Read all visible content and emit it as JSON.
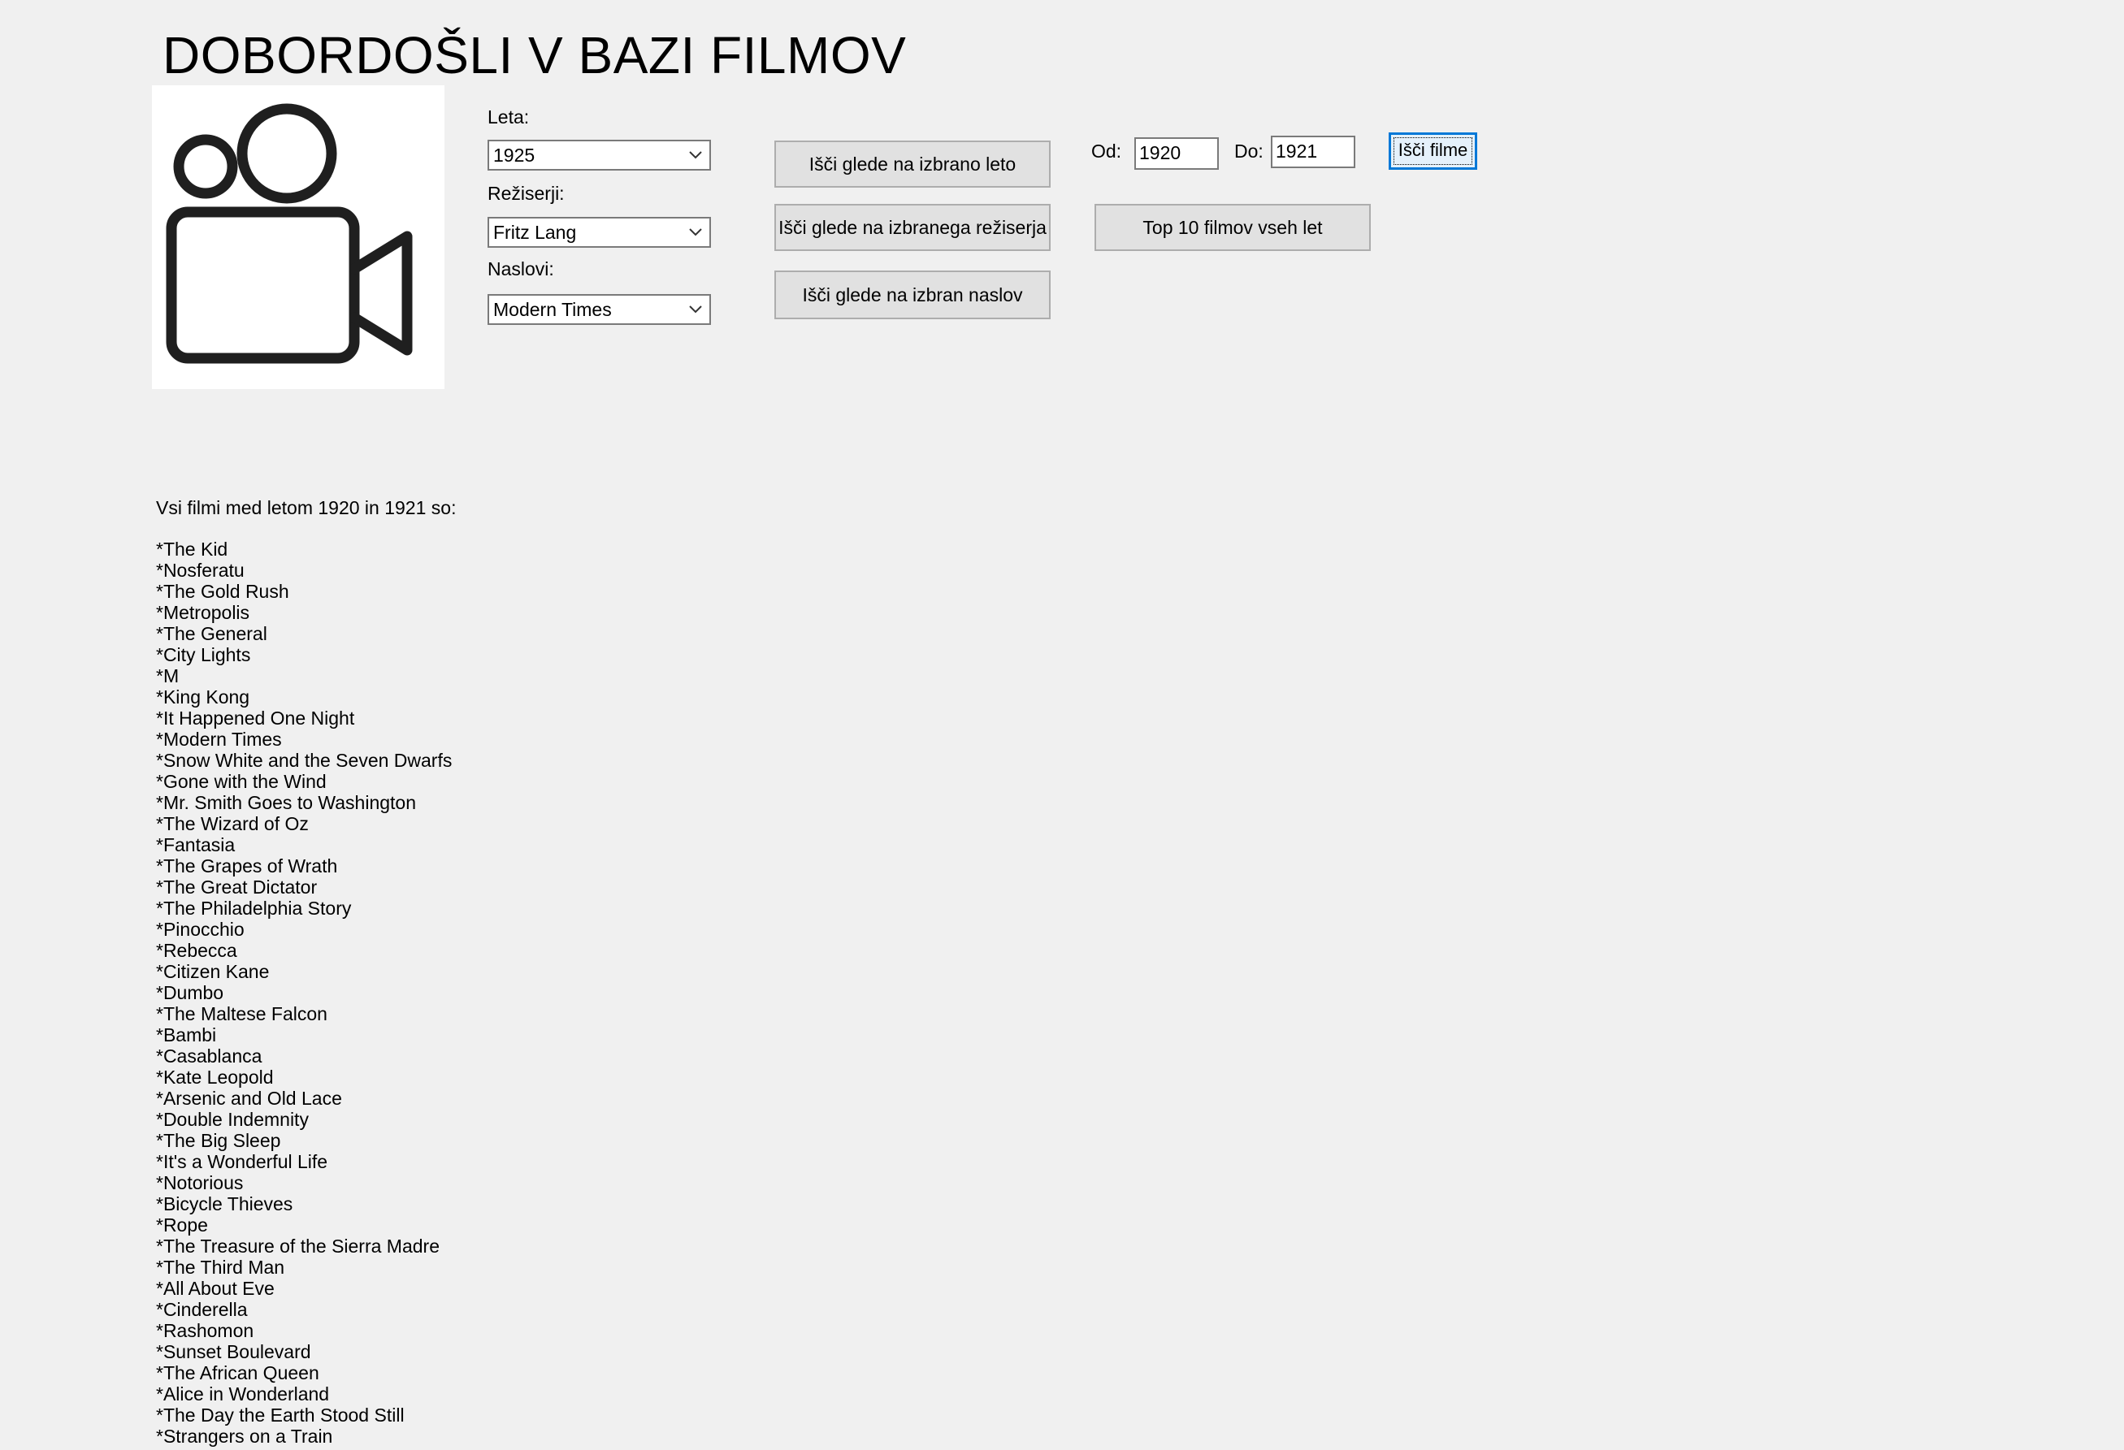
{
  "header": {
    "title": "DOBORDOŠLI V BAZI FILMOV"
  },
  "logo": {
    "icon": "video-camera-icon"
  },
  "filters": {
    "year_label": "Leta:",
    "year_selected": "1925",
    "director_label": "Režiserji:",
    "director_selected": "Fritz Lang",
    "title_label": "Naslovi:",
    "title_selected": "Modern Times"
  },
  "actions": {
    "search_year": "Išči glede na izbrano leto",
    "search_director": "Išči glede na izbranega režiserja",
    "search_title": "Išči glede na izbran naslov",
    "top10": "Top 10 filmov vseh let"
  },
  "range": {
    "from_label": "Od:",
    "from_value": "1920",
    "to_label": "Do:",
    "to_value": "1921",
    "search_button": "Išči filme"
  },
  "results": {
    "header": "Vsi filmi med letom 1920 in 1921 so:",
    "items": [
      "*The Kid",
      "*Nosferatu",
      "*The Gold Rush",
      "*Metropolis",
      "*The General",
      "*City Lights",
      "*M",
      "*King Kong",
      "*It Happened One Night",
      "*Modern Times",
      "*Snow White and the Seven Dwarfs",
      "*Gone with the Wind",
      "*Mr. Smith Goes to Washington",
      "*The Wizard of Oz",
      "*Fantasia",
      "*The Grapes of Wrath",
      "*The Great Dictator",
      "*The Philadelphia Story",
      "*Pinocchio",
      "*Rebecca",
      "*Citizen Kane",
      "*Dumbo",
      "*The Maltese Falcon",
      "*Bambi",
      "*Casablanca",
      "*Kate  Leopold",
      "*Arsenic and Old Lace",
      "*Double Indemnity",
      "*The Big Sleep",
      "*It's a Wonderful Life",
      "*Notorious",
      "*Bicycle Thieves",
      "*Rope",
      "*The Treasure of the Sierra Madre",
      "*The Third Man",
      "*All About Eve",
      "*Cinderella",
      "*Rashomon",
      "*Sunset Boulevard",
      "*The African Queen",
      "*Alice in Wonderland",
      "*The Day the Earth Stood Still",
      "*Strangers on a Train"
    ]
  }
}
